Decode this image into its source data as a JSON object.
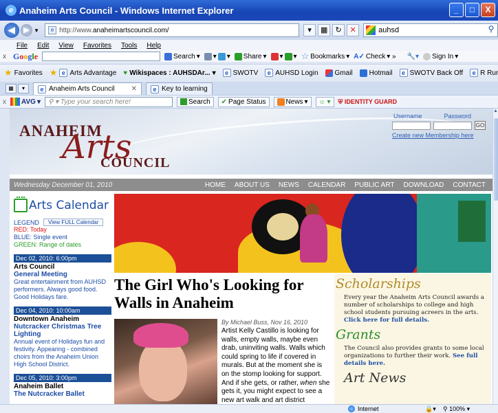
{
  "window": {
    "title": "Anaheim Arts Council - Windows Internet Explorer",
    "buttons": [
      "_",
      "□",
      "X"
    ]
  },
  "address_bar": {
    "url_prefix": "http://www.",
    "url_highlight": "anaheimartscouncil.com",
    "url_suffix": "/",
    "search_value": "auhsd"
  },
  "menu": [
    "File",
    "Edit",
    "View",
    "Favorites",
    "Tools",
    "Help"
  ],
  "google_bar": {
    "logo": "Google",
    "items": [
      "Search",
      "Share",
      "Bookmarks",
      "Check",
      "Sign In"
    ]
  },
  "favorites_bar": {
    "label": "Favorites",
    "items": [
      "Arts Advantage",
      "Wikispaces : AUHSDAr...",
      "SWOTV",
      "AUHSD Login",
      "Gmail",
      "Hotmail",
      "SWOTV Back Off",
      "R Runner"
    ]
  },
  "tabs": [
    {
      "label": "Anaheim Arts Council",
      "active": true
    },
    {
      "label": "Key to learning",
      "active": false
    }
  ],
  "avg_bar": {
    "logo": "AVG",
    "search_placeholder": "Type your search here!",
    "search_btn": "Search",
    "page_status": "Page Status",
    "news": "News",
    "identity": "IDENTITY GUARD"
  },
  "site": {
    "logo": {
      "line1": "ANAHEIM",
      "line2": "Arts",
      "line3": "COUNCIL"
    },
    "login": {
      "username_label": "Username",
      "password_label": "Password",
      "go": "GO",
      "create": "Create new Membership here"
    },
    "date": "Wednesday December 01, 2010",
    "nav": [
      "HOME",
      "ABOUT US",
      "NEWS",
      "CALENDAR",
      "PUBLIC ART",
      "DOWNLOAD",
      "CONTACT"
    ],
    "calendar": {
      "title": "Arts Calendar",
      "legend": "LEGEND",
      "view_full": "View FULL Calendar",
      "red": "RED: Today",
      "blue": "BLUE: Single event",
      "green": "GREEN: Range of dates",
      "events": [
        {
          "date": "Dec 02, 2010: 6:00pm",
          "org": "Arts Council",
          "name": "General Meeting",
          "desc": "Great entertainment from AUHSD performers. Always good food. Good Holidays fare."
        },
        {
          "date": "Dec 04, 2010: 10:00am",
          "org": "Downtown Anaheim",
          "name": "Nutcracker Christmas Tree Lighting",
          "desc": "Annual event of Holidays fun and festivity. Appearing - combined choirs from the Anaheim Union High School District."
        },
        {
          "date": "Dec 05, 2010: 3:00pm",
          "org": "Anaheim Ballet",
          "name": "The Nutcracker Ballet",
          "desc": ""
        }
      ]
    },
    "article": {
      "headline": "The Girl Who's Looking for Walls in Anaheim",
      "byline": "By Michael Buss, Nov 16, 2010",
      "body_1": "Artist Kelly Castillo is looking for walls, empty walls, maybe even drab, uninviting walls. Walls which could spring to life if covered in murals. But at the moment she is on the stomp looking for support. And if she gets, or rather, ",
      "body_em": "when",
      "body_2": " she gets it, you might expect to see a new art walk and art district"
    },
    "sidebar": {
      "scholarships_title": "Scholarships",
      "scholarships_text": "Every year the Anaheim Arts Council awards a number of scholarships to college and high school students pursuing acreers in the arts. ",
      "scholarships_link": "Click here for full details.",
      "grants_title": "Grants",
      "grants_text": "The Council also provides grants to some local organizations to further their work. ",
      "grants_link": "See full details here.",
      "news_title": "Art News"
    }
  },
  "status": {
    "zone": "Internet",
    "zoom": "100%"
  }
}
